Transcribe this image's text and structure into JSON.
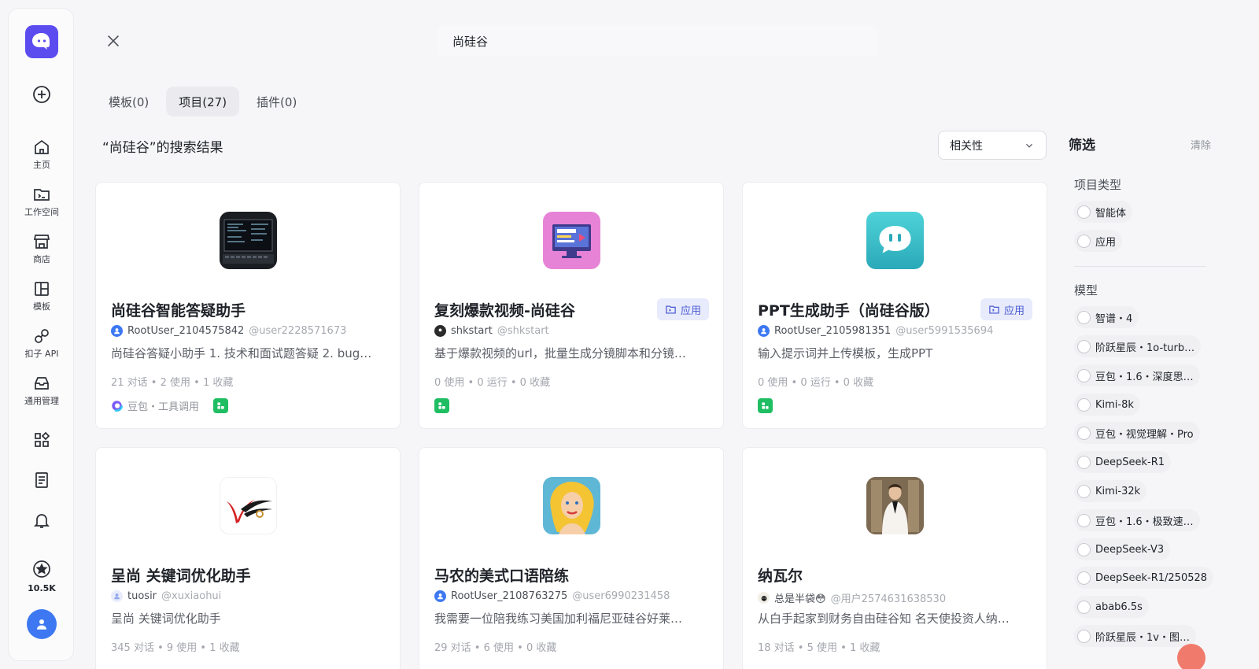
{
  "rail": {
    "nav": [
      {
        "label": "主页",
        "icon": "home-icon"
      },
      {
        "label": "工作空间",
        "icon": "workspace-icon"
      },
      {
        "label": "商店",
        "icon": "store-icon"
      },
      {
        "label": "模板",
        "icon": "template-icon"
      },
      {
        "label": "扣子 API",
        "icon": "api-icon"
      },
      {
        "label": "通用管理",
        "icon": "inbox-icon"
      }
    ],
    "stars_count": "10.5K"
  },
  "search": {
    "value": "尚硅谷"
  },
  "tabs": [
    {
      "label": "模板(0)",
      "active": false
    },
    {
      "label": "项目(27)",
      "active": true
    },
    {
      "label": "插件(0)",
      "active": false
    }
  ],
  "result_title": "“尚硅谷”的搜索结果",
  "sort": {
    "selected": "相关性"
  },
  "colors": {
    "accent": "#5b4cf0",
    "blue": "#3d78f2",
    "green": "#1fbe63",
    "badge_bg": "#e8ebfb"
  },
  "cards": [
    {
      "name": "尚硅谷智能答疑助手",
      "badge": "",
      "author": "RootUser_2104575842",
      "handle": "@user2228571673",
      "desc": "尚硅谷答疑小助手 1. 技术和面试题答疑 2. bug…",
      "stats": "21 对话 • 2 使用 • 1 收藏",
      "model": "豆包・工具调用"
    },
    {
      "name": "复刻爆款视频-尚硅谷",
      "badge": "应用",
      "author": "shkstart",
      "handle": "@shkstart",
      "desc": "基于爆款视频的url，批量生成分镜脚本和分镜…",
      "stats": "0 使用 • 0 运行 • 0 收藏",
      "model": ""
    },
    {
      "name": "PPT生成助手（尚硅谷版）",
      "badge": "应用",
      "author": "RootUser_2105981351",
      "handle": "@user5991535694",
      "desc": "输入提示词并上传模板，生成PPT",
      "stats": "0 使用 • 0 运行 • 0 收藏",
      "model": ""
    },
    {
      "name": "呈尚 关键词优化助手",
      "badge": "",
      "author": "tuosir",
      "handle": "@xuxiaohui",
      "desc": "呈尚 关键词优化助手",
      "stats": "345 对话 • 9 使用 • 1 收藏",
      "model": ""
    },
    {
      "name": "马农的美式口语陪练",
      "badge": "",
      "author": "RootUser_2108763275",
      "handle": "@user6990231458",
      "desc": "我需要一位陪我练习美国加利福尼亚硅谷好莱…",
      "stats": "29 对话 • 6 使用 • 0 收藏",
      "model": ""
    },
    {
      "name": "纳瓦尔",
      "badge": "",
      "author": "总是半袋😳",
      "handle": "@用户2574631638530",
      "desc": "从白手起家到财务自由硅谷知 名天使投资人纳…",
      "stats": "18 对话 • 5 使用 • 1 收藏",
      "model": ""
    }
  ],
  "filter": {
    "title": "筛选",
    "clear": "清除",
    "type_title": "项目类型",
    "types": [
      "智能体",
      "应用"
    ],
    "model_title": "模型",
    "models": [
      "智谱・4",
      "阶跃星辰・1o-turb…",
      "豆包・1.6・深度思…",
      "Kimi-8k",
      "豆包・视觉理解・Pro",
      "DeepSeek-R1",
      "Kimi-32k",
      "豆包・1.6・极致速…",
      "DeepSeek-V3",
      "DeepSeek-R1/250528",
      "abab6.5s",
      "阶跃星辰・1v・图…"
    ]
  }
}
